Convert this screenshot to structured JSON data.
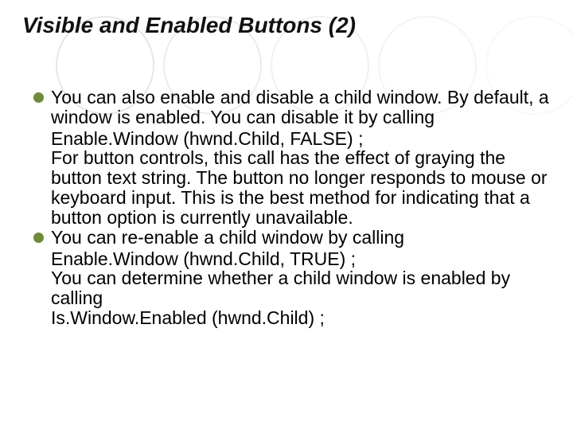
{
  "title": "Visible and Enabled Buttons (2)",
  "bullets": [
    {
      "intro": "You can also enable and disable a child window. By default, a window is enabled. You can disable it by calling",
      "code1": "Enable.Window (hwnd.Child, FALSE) ;",
      "explain": "For button controls, this call has the effect of graying the button text string. The button no longer responds to mouse or keyboard input. This is the best method for indicating that a button option is currently unavailable."
    },
    {
      "intro": "You can re-enable a child window by calling",
      "code1": "Enable.Window (hwnd.Child, TRUE) ;",
      "explain": "You can determine whether a child window is enabled by calling",
      "code2": "Is.Window.Enabled (hwnd.Child) ;"
    }
  ]
}
